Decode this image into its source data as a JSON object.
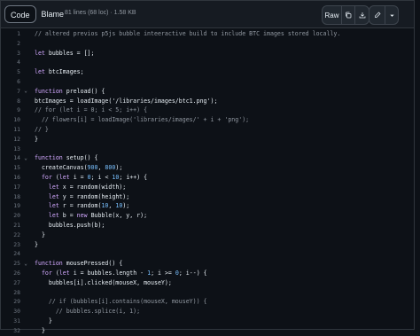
{
  "tabs": {
    "code": "Code",
    "blame": "Blame"
  },
  "file_info": "81 lines (68 loc) · 1.58 KB",
  "toolbar": {
    "raw": "Raw"
  },
  "colors": {
    "keyword": "#d2a8ff",
    "comment": "#9198a1",
    "text": "#e6edf3",
    "number": "#79c0ff"
  },
  "lines": [
    {
      "num": "1",
      "fold": "",
      "code": "// altered previos p5js bubble inteeractive build to include BTC images stored locally."
    },
    {
      "num": "2",
      "fold": "",
      "code": ""
    },
    {
      "num": "3",
      "fold": "",
      "code": "let bubbles = [];"
    },
    {
      "num": "4",
      "fold": "",
      "code": ""
    },
    {
      "num": "5",
      "fold": "",
      "code": "let btcImages;"
    },
    {
      "num": "6",
      "fold": "",
      "code": ""
    },
    {
      "num": "7",
      "fold": "⌄",
      "code": "function preload() {"
    },
    {
      "num": "8",
      "fold": "",
      "code": "btcImages = loadImage('/libraries/images/btc1.png');"
    },
    {
      "num": "9",
      "fold": "",
      "code": "// for (let i = 0; i < 5; i++) {"
    },
    {
      "num": "10",
      "fold": "",
      "code": "  // flowers[i] = loadImage('libraries/images/' + i + 'png');"
    },
    {
      "num": "11",
      "fold": "",
      "code": "// }"
    },
    {
      "num": "12",
      "fold": "",
      "code": "}"
    },
    {
      "num": "13",
      "fold": "",
      "code": ""
    },
    {
      "num": "14",
      "fold": "⌄",
      "code": "function setup() {"
    },
    {
      "num": "15",
      "fold": "",
      "code": "  createCanvas(900, 800);"
    },
    {
      "num": "16",
      "fold": "",
      "code": "  for (let i = 0; i < 10; i++) {"
    },
    {
      "num": "17",
      "fold": "",
      "code": "    let x = random(width);"
    },
    {
      "num": "18",
      "fold": "",
      "code": "    let y = random(height);"
    },
    {
      "num": "19",
      "fold": "",
      "code": "    let r = random(10, 10);"
    },
    {
      "num": "20",
      "fold": "",
      "code": "    let b = new Bubble(x, y, r);"
    },
    {
      "num": "21",
      "fold": "",
      "code": "    bubbles.push(b);"
    },
    {
      "num": "22",
      "fold": "",
      "code": "  }"
    },
    {
      "num": "23",
      "fold": "",
      "code": "}"
    },
    {
      "num": "24",
      "fold": "",
      "code": ""
    },
    {
      "num": "25",
      "fold": "⌄",
      "code": "function mousePressed() {"
    },
    {
      "num": "26",
      "fold": "",
      "code": "  for (let i = bubbles.length - 1; i >= 0; i--) {"
    },
    {
      "num": "27",
      "fold": "",
      "code": "    bubbles[i].clicked(mouseX, mouseY);"
    },
    {
      "num": "28",
      "fold": "",
      "code": ""
    },
    {
      "num": "29",
      "fold": "",
      "code": "    // if (bubbles[i].contains(mouseX, mouseY)) {"
    },
    {
      "num": "30",
      "fold": "",
      "code": "      // bubbles.splice(i, 1);"
    },
    {
      "num": "31",
      "fold": "",
      "code": "    }"
    },
    {
      "num": "32",
      "fold": "",
      "code": "  }"
    }
  ]
}
